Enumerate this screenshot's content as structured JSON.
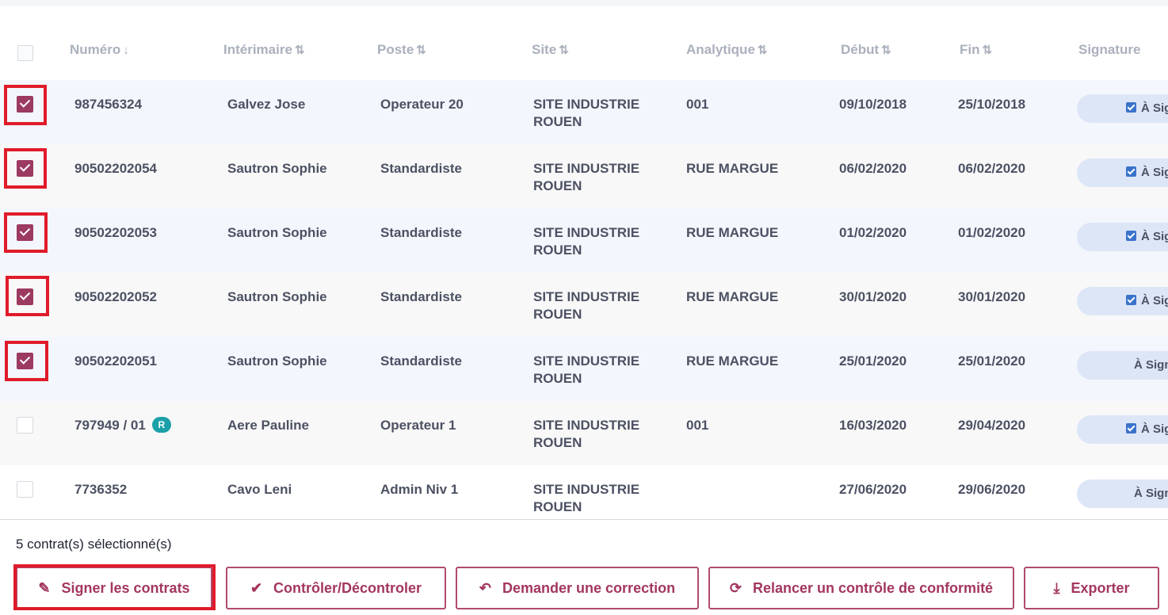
{
  "table": {
    "columns": [
      {
        "label": "Numéro",
        "sort": "↓"
      },
      {
        "label": "Intérimaire",
        "sort": "⇅"
      },
      {
        "label": "Poste",
        "sort": "⇅"
      },
      {
        "label": "Site",
        "sort": "⇅"
      },
      {
        "label": "Analytique",
        "sort": "⇅"
      },
      {
        "label": "Début",
        "sort": "⇅"
      },
      {
        "label": "Fin",
        "sort": "⇅"
      },
      {
        "label": "Signature",
        "sort": ""
      }
    ],
    "rows": [
      {
        "checked": true,
        "numero": "987456324",
        "badge": "",
        "interimaire": "Galvez Jose",
        "poste": "Operateur 20",
        "site": "SITE INDUSTRIE ROUEN",
        "analytique": "001",
        "debut": "09/10/2018",
        "fin": "25/10/2018",
        "signature": "À Signer",
        "sig_checkbox": true
      },
      {
        "checked": true,
        "numero": "90502202054",
        "badge": "",
        "interimaire": "Sautron Sophie",
        "poste": "Standardiste",
        "site": "SITE INDUSTRIE ROUEN",
        "analytique": "RUE MARGUE",
        "debut": "06/02/2020",
        "fin": "06/02/2020",
        "signature": "À Signer",
        "sig_checkbox": true
      },
      {
        "checked": true,
        "numero": "90502202053",
        "badge": "",
        "interimaire": "Sautron Sophie",
        "poste": "Standardiste",
        "site": "SITE INDUSTRIE ROUEN",
        "analytique": "RUE MARGUE",
        "debut": "01/02/2020",
        "fin": "01/02/2020",
        "signature": "À Signer",
        "sig_checkbox": true
      },
      {
        "checked": true,
        "numero": "90502202052",
        "badge": "",
        "interimaire": "Sautron Sophie",
        "poste": "Standardiste",
        "site": "SITE INDUSTRIE ROUEN",
        "analytique": "RUE MARGUE",
        "debut": "30/01/2020",
        "fin": "30/01/2020",
        "signature": "À Signer",
        "sig_checkbox": true
      },
      {
        "checked": true,
        "numero": "90502202051",
        "badge": "",
        "interimaire": "Sautron Sophie",
        "poste": "Standardiste",
        "site": "SITE INDUSTRIE ROUEN",
        "analytique": "RUE MARGUE",
        "debut": "25/01/2020",
        "fin": "25/01/2020",
        "signature": "À Signer",
        "sig_checkbox": false
      },
      {
        "checked": false,
        "numero": "797949 / 01",
        "badge": "R",
        "interimaire": "Aere Pauline",
        "poste": "Operateur 1",
        "site": "SITE INDUSTRIE ROUEN",
        "analytique": "001",
        "debut": "16/03/2020",
        "fin": "29/04/2020",
        "signature": "À Signer",
        "sig_checkbox": true
      },
      {
        "checked": false,
        "numero": "7736352",
        "badge": "",
        "interimaire": "Cavo Leni",
        "poste": "Admin Niv 1",
        "site": "SITE INDUSTRIE ROUEN",
        "analytique": "",
        "debut": "27/06/2020",
        "fin": "29/06/2020",
        "signature": "À Signer",
        "sig_checkbox": false
      }
    ]
  },
  "footer": {
    "selection_text": "5 contrat(s) sélectionné(s)",
    "buttons": [
      {
        "label": "Signer les contrats",
        "icon": "pencil-icon"
      },
      {
        "label": "Contrôler/Décontroler",
        "icon": "check-icon"
      },
      {
        "label": "Demander une correction",
        "icon": "reply-arrow-icon"
      },
      {
        "label": "Relancer un contrôle de conformité",
        "icon": "refresh-icon"
      },
      {
        "label": "Exporter",
        "icon": "download-icon"
      }
    ]
  },
  "colors": {
    "accent": "#a3365f",
    "highlight": "#e01b2a",
    "badge": "#1ca0a8",
    "signature_pill": "#dde6f7"
  }
}
